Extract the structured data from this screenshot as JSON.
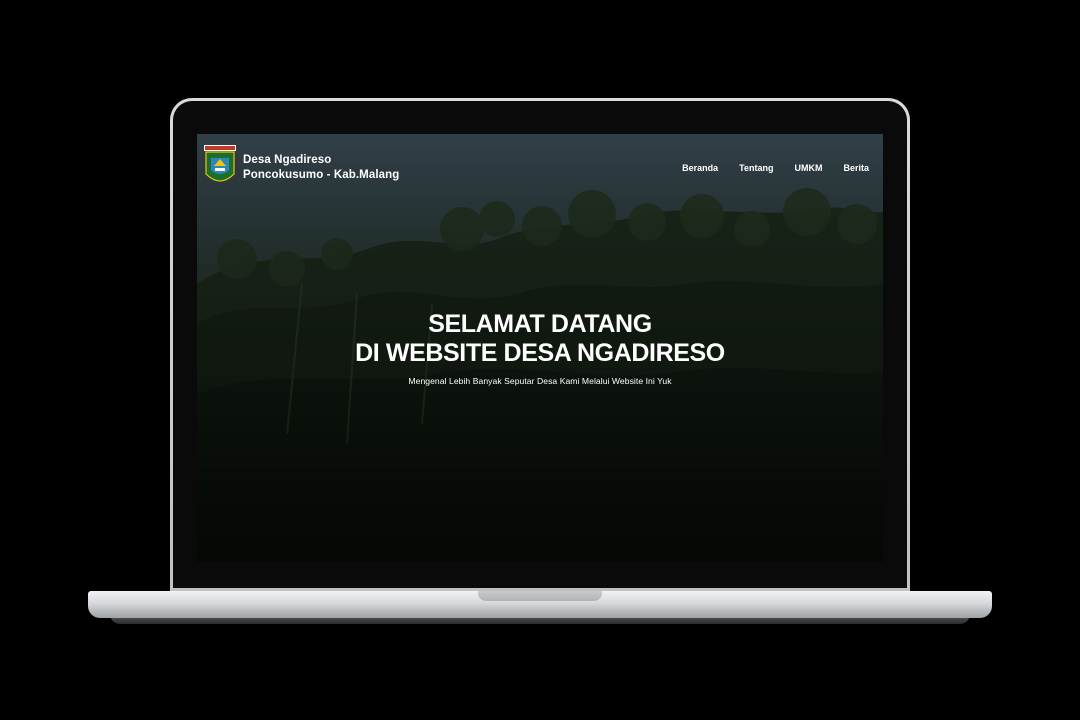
{
  "header": {
    "logo_icon": "kabupaten-malang-emblem-icon",
    "site_name": "Desa Ngadireso",
    "site_location": "Poncokusumo - Kab.Malang"
  },
  "nav": {
    "items": [
      {
        "label": "Beranda"
      },
      {
        "label": "Tentang"
      },
      {
        "label": "UMKM"
      },
      {
        "label": "Berita"
      }
    ]
  },
  "hero": {
    "title_line1": "SELAMAT DATANG",
    "title_line2": "DI WEBSITE DESA NGADIRESO",
    "subtitle": "Mengenal Lebih Banyak Seputar Desa Kami Melalui Website Ini Yuk"
  },
  "colors": {
    "overlay": "#000000",
    "text": "#ffffff",
    "device_frame": "#d0d2d5"
  }
}
